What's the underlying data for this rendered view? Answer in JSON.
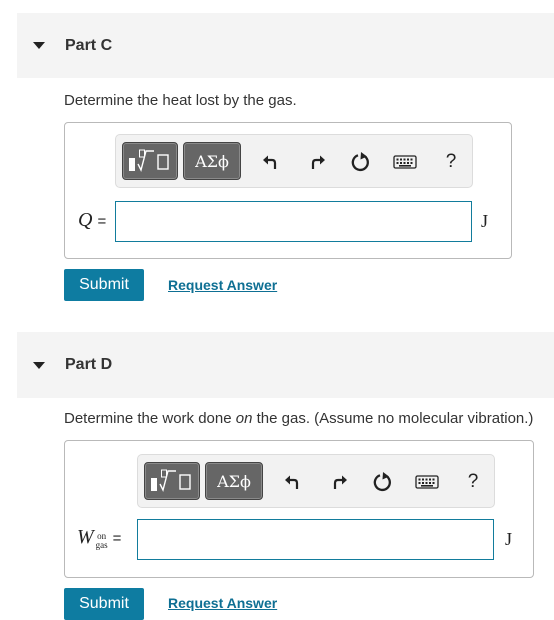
{
  "partC": {
    "title": "Part C",
    "prompt": "Determine the heat lost by the gas.",
    "toolbar": {
      "templates_icon": "fraction-root-icon",
      "greek_label": "ΑΣϕ",
      "help_label": "?"
    },
    "variable": "Q",
    "equals": "=",
    "unit": "J",
    "input_value": "",
    "submit_label": "Submit",
    "request_label": "Request Answer"
  },
  "partD": {
    "title": "Part D",
    "prompt_before": "Determine the work done ",
    "prompt_em": "on",
    "prompt_after": " the gas. (Assume no molecular vibration.)",
    "toolbar": {
      "templates_icon": "fraction-root-icon",
      "greek_label": "ΑΣϕ",
      "help_label": "?"
    },
    "variable": "W",
    "subscript_top": "on",
    "subscript_bottom": "gas",
    "equals": "=",
    "unit": "J",
    "input_value": "",
    "submit_label": "Submit",
    "request_label": "Request Answer"
  },
  "colors": {
    "accent": "#0e7ca1",
    "header_bg": "#f4f4f4",
    "input_border": "#127c9c"
  }
}
